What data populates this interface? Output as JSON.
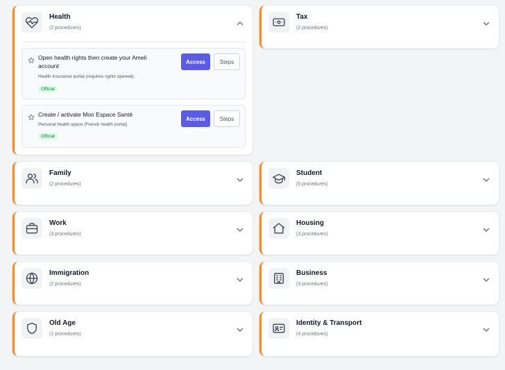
{
  "categories": {
    "health": {
      "title": "Health",
      "count": "(2 procedures)",
      "procedures": [
        {
          "title": "Open health rights then create your Ameli account",
          "description": "Health insurance portal (requires rights opened).",
          "badge": "Official",
          "access_label": "Access",
          "steps_label": "Steps"
        },
        {
          "title": "Create / activate Mon Espace Santé",
          "description": "Personal health space (French health portal)",
          "badge": "Official",
          "access_label": "Access",
          "steps_label": "Steps"
        }
      ]
    },
    "tax": {
      "title": "Tax",
      "count": "(2 procedures)"
    },
    "family": {
      "title": "Family",
      "count": "(2 procedures)"
    },
    "student": {
      "title": "Student",
      "count": "(5 procedures)"
    },
    "work": {
      "title": "Work",
      "count": "(3 procedures)"
    },
    "housing": {
      "title": "Housing",
      "count": "(3 procedures)"
    },
    "immigration": {
      "title": "Immigration",
      "count": "(2 procedures)"
    },
    "business": {
      "title": "Business",
      "count": "(3 procedures)"
    },
    "old_age": {
      "title": "Old Age",
      "count": "(1 procedures)"
    },
    "identity": {
      "title": "Identity & Transport",
      "count": "(4 procedures)"
    }
  },
  "icons": {
    "health": "heart-pulse-icon",
    "tax": "banknote-icon",
    "family": "users-icon",
    "student": "graduation-cap-icon",
    "work": "briefcase-icon",
    "housing": "home-icon",
    "immigration": "globe-icon",
    "business": "building-icon",
    "old_age": "shield-icon",
    "identity": "id-card-icon",
    "expanded": "chevron-up-icon",
    "collapsed": "chevron-down-icon",
    "favorite": "star-icon"
  },
  "colors": {
    "accent_border": "#f08a34",
    "primary_button": "#5b5be6",
    "badge_bg": "#dcfce7",
    "badge_text": "#15803d",
    "background": "#f3f4f6"
  }
}
